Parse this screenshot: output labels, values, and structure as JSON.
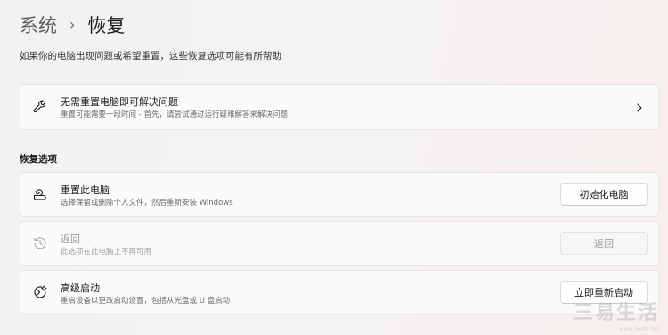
{
  "breadcrumb": {
    "parent": "系统",
    "separator": "›",
    "current": "恢复"
  },
  "description": "如果你的电脑出现问题或希望重置，这些恢复选项可能有所帮助",
  "troubleshoot_card": {
    "icon": "wrench-icon",
    "title": "无需重置电脑即可解决问题",
    "subtitle": "重置可能需要一段时间 - 首先，请尝试通过运行疑难解答来解决问题"
  },
  "section_title": "恢复选项",
  "recovery_options": [
    {
      "icon": "reset-pc-icon",
      "title": "重置此电脑",
      "subtitle": "选择保留或删除个人文件，然后重新安装 Windows",
      "button_label": "初始化电脑",
      "enabled": true
    },
    {
      "icon": "history-icon",
      "title": "返回",
      "subtitle": "此选项在此电脑上不再可用",
      "button_label": "返回",
      "enabled": false
    },
    {
      "icon": "advanced-startup-icon",
      "title": "高级启动",
      "subtitle": "重启设备以更改启动设置，包括从光盘或 U 盘启动",
      "button_label": "立即重新启动",
      "enabled": true
    }
  ],
  "watermark": {
    "text": "三易生活",
    "url": "www.3elife.net"
  },
  "colors": {
    "background": "#f4f2f2",
    "card": "#fbfafa",
    "text_primary": "#1b1b1b",
    "text_secondary": "#6b6b6b",
    "text_disabled": "#9a9a9a"
  }
}
